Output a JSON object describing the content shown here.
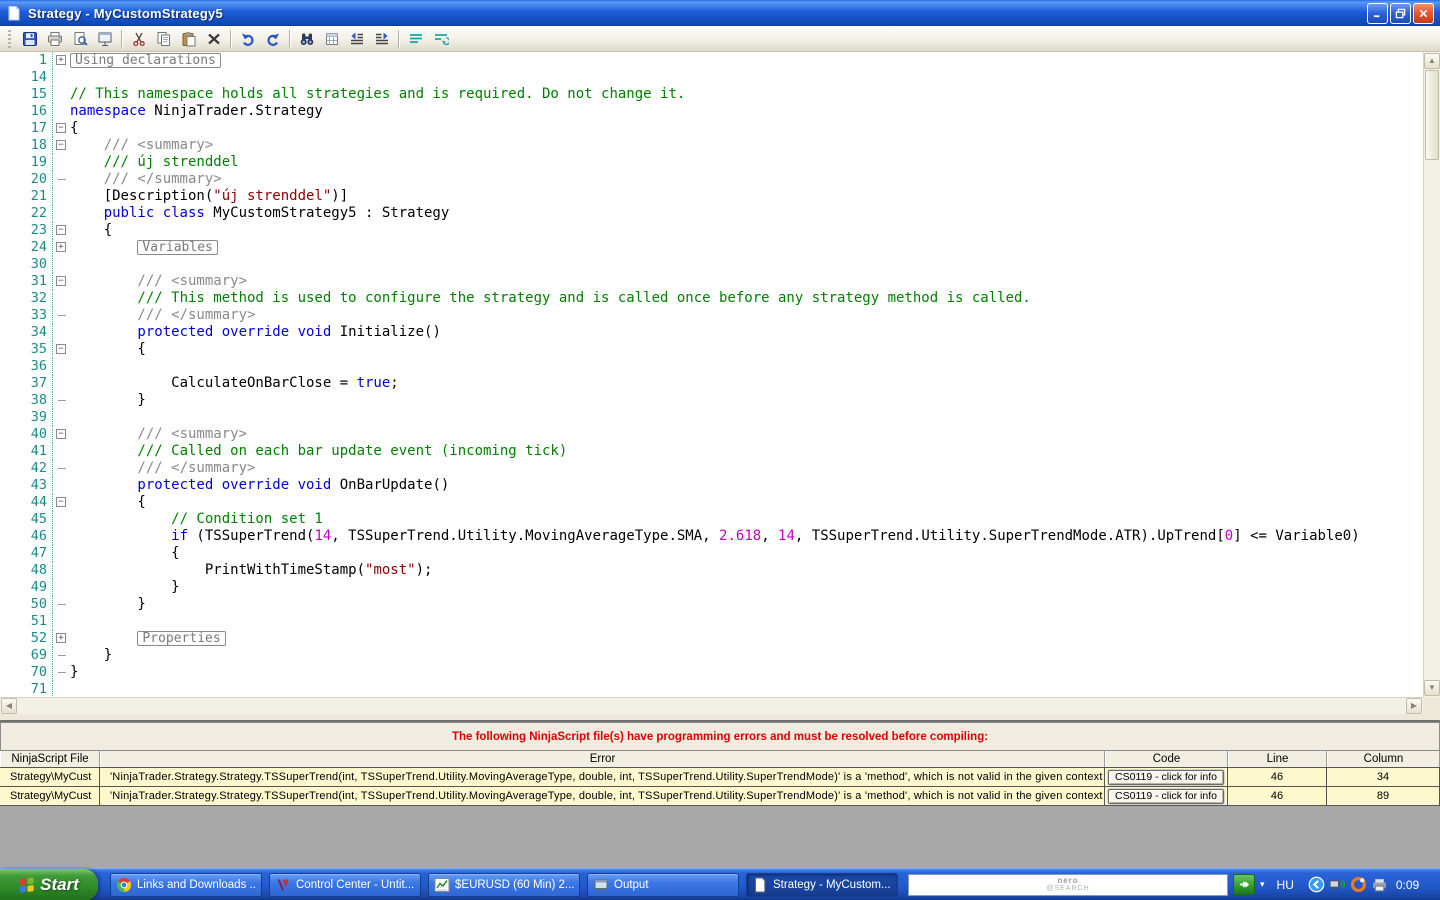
{
  "window": {
    "title": "Strategy - MyCustomStrategy5"
  },
  "toolbar": {
    "groups": [
      [
        "save",
        "print",
        "print-preview",
        "output-window"
      ],
      [
        "cut",
        "copy",
        "paste",
        "delete"
      ],
      [
        "undo",
        "redo"
      ],
      [
        "find",
        "insert-special",
        "outdent",
        "indent"
      ],
      [
        "goto-line",
        "uncomment"
      ]
    ]
  },
  "editor": {
    "colors": {
      "keyword": "#0000dd",
      "comment": "#008000",
      "doc": "#8a8a8a",
      "string": "#8b0000",
      "number": "#c400c4",
      "plain": "#000000",
      "line_number": "#1b8a8a"
    },
    "lines": [
      {
        "n": "1",
        "f": "p",
        "i": 0,
        "box": "Using declarations"
      },
      {
        "n": "14"
      },
      {
        "n": "15",
        "i": 0,
        "s": [
          [
            "cm",
            "// This namespace holds all strategies and is required. Do not change it."
          ]
        ]
      },
      {
        "n": "16",
        "i": 0,
        "s": [
          [
            "kw",
            "namespace"
          ],
          [
            "pl",
            " NinjaTrader.Strategy"
          ]
        ]
      },
      {
        "n": "17",
        "f": "m",
        "i": 0,
        "s": [
          [
            "pl",
            "{"
          ]
        ]
      },
      {
        "n": "18",
        "f": "m",
        "i": 1,
        "s": [
          [
            "doc",
            "/// <summary>"
          ]
        ]
      },
      {
        "n": "19",
        "i": 1,
        "s": [
          [
            "cm",
            "/// új strenddel"
          ]
        ]
      },
      {
        "n": "20",
        "f": "e",
        "i": 1,
        "s": [
          [
            "doc",
            "/// </summary>"
          ]
        ]
      },
      {
        "n": "21",
        "i": 1,
        "s": [
          [
            "pl",
            "[Description("
          ],
          [
            "str",
            "\"új strenddel\""
          ],
          [
            "pl",
            ")]"
          ]
        ]
      },
      {
        "n": "22",
        "i": 1,
        "s": [
          [
            "kw",
            "public class"
          ],
          [
            "pl",
            " MyCustomStrategy5 : Strategy"
          ]
        ]
      },
      {
        "n": "23",
        "f": "m",
        "i": 1,
        "s": [
          [
            "pl",
            "{"
          ]
        ]
      },
      {
        "n": "24",
        "f": "p",
        "i": 2,
        "box": "Variables"
      },
      {
        "n": "30"
      },
      {
        "n": "31",
        "f": "m",
        "i": 2,
        "s": [
          [
            "doc",
            "/// <summary>"
          ]
        ]
      },
      {
        "n": "32",
        "i": 2,
        "s": [
          [
            "cm",
            "/// This method is used to configure the strategy and is called once before any strategy method is called."
          ]
        ]
      },
      {
        "n": "33",
        "f": "e",
        "i": 2,
        "s": [
          [
            "doc",
            "/// </summary>"
          ]
        ]
      },
      {
        "n": "34",
        "i": 2,
        "s": [
          [
            "kw",
            "protected override void"
          ],
          [
            "pl",
            " Initialize()"
          ]
        ]
      },
      {
        "n": "35",
        "f": "m",
        "i": 2,
        "s": [
          [
            "pl",
            "{"
          ]
        ]
      },
      {
        "n": "36"
      },
      {
        "n": "37",
        "i": 3,
        "s": [
          [
            "pl",
            "CalculateOnBarClose = "
          ],
          [
            "kw",
            "true"
          ],
          [
            "pl",
            ";"
          ]
        ]
      },
      {
        "n": "38",
        "f": "e",
        "i": 2,
        "s": [
          [
            "pl",
            "}"
          ]
        ]
      },
      {
        "n": "39"
      },
      {
        "n": "40",
        "f": "m",
        "i": 2,
        "s": [
          [
            "doc",
            "/// <summary>"
          ]
        ]
      },
      {
        "n": "41",
        "i": 2,
        "s": [
          [
            "cm",
            "/// Called on each bar update event (incoming tick)"
          ]
        ]
      },
      {
        "n": "42",
        "f": "e",
        "i": 2,
        "s": [
          [
            "doc",
            "/// </summary>"
          ]
        ]
      },
      {
        "n": "43",
        "i": 2,
        "s": [
          [
            "kw",
            "protected override void"
          ],
          [
            "pl",
            " OnBarUpdate()"
          ]
        ]
      },
      {
        "n": "44",
        "f": "m",
        "i": 2,
        "s": [
          [
            "pl",
            "{"
          ]
        ]
      },
      {
        "n": "45",
        "i": 3,
        "s": [
          [
            "cm",
            "// Condition set 1"
          ]
        ]
      },
      {
        "n": "46",
        "i": 3,
        "s": [
          [
            "kw",
            "if"
          ],
          [
            "pl",
            " (TSSuperTrend("
          ],
          [
            "num",
            "14"
          ],
          [
            "pl",
            ", TSSuperTrend.Utility.MovingAverageType.SMA, "
          ],
          [
            "num",
            "2.618"
          ],
          [
            "pl",
            ", "
          ],
          [
            "num",
            "14"
          ],
          [
            "pl",
            ", TSSuperTrend.Utility.SuperTrendMode.ATR).UpTrend["
          ],
          [
            "num",
            "0"
          ],
          [
            "pl",
            "] <= Variable0)"
          ]
        ]
      },
      {
        "n": "47",
        "i": 3,
        "s": [
          [
            "pl",
            "{"
          ]
        ]
      },
      {
        "n": "48",
        "i": 4,
        "s": [
          [
            "pl",
            "PrintWithTimeStamp("
          ],
          [
            "str",
            "\"most\""
          ],
          [
            "pl",
            ");"
          ]
        ]
      },
      {
        "n": "49",
        "i": 3,
        "s": [
          [
            "pl",
            "}"
          ]
        ]
      },
      {
        "n": "50",
        "f": "e",
        "i": 2,
        "s": [
          [
            "pl",
            "}"
          ]
        ]
      },
      {
        "n": "51"
      },
      {
        "n": "52",
        "f": "p",
        "i": 2,
        "box": "Properties"
      },
      {
        "n": "69",
        "f": "e",
        "i": 1,
        "s": [
          [
            "pl",
            "}"
          ]
        ]
      },
      {
        "n": "70",
        "f": "e",
        "i": 0,
        "s": [
          [
            "pl",
            "}"
          ]
        ]
      },
      {
        "n": "71"
      }
    ]
  },
  "error_panel": {
    "header": "The following NinjaScript file(s) have programming errors and must be resolved before compiling:",
    "columns": [
      "NinjaScript File",
      "Error",
      "Code",
      "Line",
      "Column"
    ],
    "rows": [
      {
        "file": "Strategy\\MyCust",
        "error": "'NinjaTrader.Strategy.Strategy.TSSuperTrend(int, TSSuperTrend.Utility.MovingAverageType, double, int, TSSuperTrend.Utility.SuperTrendMode)' is a 'method', which is not valid in the given context",
        "code": "CS0119 - click for info",
        "line": "46",
        "column": "34"
      },
      {
        "file": "Strategy\\MyCust",
        "error": "'NinjaTrader.Strategy.Strategy.TSSuperTrend(int, TSSuperTrend.Utility.MovingAverageType, double, int, TSSuperTrend.Utility.SuperTrendMode)' is a 'method', which is not valid in the given context",
        "code": "CS0119 - click for info",
        "line": "46",
        "column": "89"
      }
    ]
  },
  "taskbar": {
    "start_label": "Start",
    "tasks": [
      {
        "label": "Links and Downloads ...",
        "icon": "chrome",
        "active": false
      },
      {
        "label": "Control Center - Untit...",
        "icon": "ninjatrader",
        "active": false
      },
      {
        "label": "$EURUSD (60 Min)  2...",
        "icon": "chart",
        "active": false
      },
      {
        "label": "Output",
        "icon": "output",
        "active": false
      },
      {
        "label": "Strategy - MyCustom...",
        "icon": "document",
        "active": true
      }
    ],
    "search_watermark_line1": "nero",
    "search_watermark_line2": "@SEARCH",
    "language": "HU",
    "tray_icons": [
      "hide-icons",
      "volume",
      "nero-agent",
      "printer"
    ],
    "clock": "0:09"
  }
}
